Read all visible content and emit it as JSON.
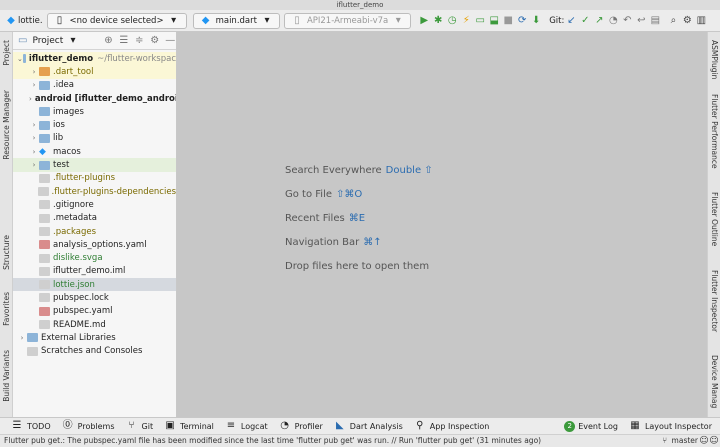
{
  "window": {
    "title": "iflutter_demo"
  },
  "toolbar": {
    "project_crumb": "lottie.",
    "device": "<no device selected>",
    "run_config": "main.dart",
    "emulator": "API21-Armeabi-v7a",
    "git_label": "Git:"
  },
  "project_panel": {
    "title": "Project",
    "tree": [
      {
        "label": "iflutter_demo",
        "extra": "~/flutter-workspac",
        "depth": 0,
        "expand": "open",
        "icon": "folder",
        "bold": true,
        "color": "#222",
        "hl": "yellow"
      },
      {
        "label": ".dart_tool",
        "depth": 1,
        "expand": "closed",
        "icon": "folder-orange",
        "color": "#7a6a00",
        "hl": "yellow"
      },
      {
        "label": ".idea",
        "depth": 1,
        "expand": "closed",
        "icon": "folder",
        "color": "#222",
        "hl": ""
      },
      {
        "label": "android [iflutter_demo_androi",
        "depth": 1,
        "expand": "closed",
        "icon": "folder",
        "bold": true,
        "color": "#222",
        "hl": ""
      },
      {
        "label": "images",
        "depth": 1,
        "expand": "none",
        "icon": "folder",
        "color": "#222",
        "hl": ""
      },
      {
        "label": "ios",
        "depth": 1,
        "expand": "closed",
        "icon": "folder",
        "color": "#222",
        "hl": ""
      },
      {
        "label": "lib",
        "depth": 1,
        "expand": "closed",
        "icon": "folder",
        "color": "#222",
        "hl": ""
      },
      {
        "label": "macos",
        "depth": 1,
        "expand": "closed",
        "icon": "flutter",
        "color": "#222",
        "hl": ""
      },
      {
        "label": "test",
        "depth": 1,
        "expand": "closed",
        "icon": "folder",
        "color": "#222",
        "hl": "green"
      },
      {
        "label": ".flutter-plugins",
        "depth": 1,
        "expand": "none",
        "icon": "file",
        "color": "#7a6a00",
        "hl": ""
      },
      {
        "label": ".flutter-plugins-dependencies",
        "depth": 1,
        "expand": "none",
        "icon": "file",
        "color": "#7a6a00",
        "hl": ""
      },
      {
        "label": ".gitignore",
        "depth": 1,
        "expand": "none",
        "icon": "file",
        "color": "#222",
        "hl": ""
      },
      {
        "label": ".metadata",
        "depth": 1,
        "expand": "none",
        "icon": "file",
        "color": "#222",
        "hl": ""
      },
      {
        "label": ".packages",
        "depth": 1,
        "expand": "none",
        "icon": "file",
        "color": "#7a6a00",
        "hl": ""
      },
      {
        "label": "analysis_options.yaml",
        "depth": 1,
        "expand": "none",
        "icon": "yaml",
        "color": "#222",
        "hl": ""
      },
      {
        "label": "dislike.svga",
        "depth": 1,
        "expand": "none",
        "icon": "file",
        "color": "#2e7d32",
        "hl": ""
      },
      {
        "label": "iflutter_demo.iml",
        "depth": 1,
        "expand": "none",
        "icon": "file",
        "color": "#222",
        "hl": ""
      },
      {
        "label": "lottie.json",
        "depth": 1,
        "expand": "none",
        "icon": "file",
        "color": "#2e7d32",
        "hl": "sel"
      },
      {
        "label": "pubspec.lock",
        "depth": 1,
        "expand": "none",
        "icon": "file",
        "color": "#222",
        "hl": ""
      },
      {
        "label": "pubspec.yaml",
        "depth": 1,
        "expand": "none",
        "icon": "yaml",
        "color": "#222",
        "hl": ""
      },
      {
        "label": "README.md",
        "depth": 1,
        "expand": "none",
        "icon": "file",
        "color": "#222",
        "hl": ""
      },
      {
        "label": "External Libraries",
        "depth": 0,
        "expand": "closed",
        "icon": "lib",
        "color": "#222",
        "hl": ""
      },
      {
        "label": "Scratches and Consoles",
        "depth": 0,
        "expand": "none",
        "icon": "scratch",
        "color": "#222",
        "hl": ""
      }
    ]
  },
  "editor_hints": [
    {
      "text": "Search Everywhere",
      "key": "Double ⇧"
    },
    {
      "text": "Go to File",
      "key": "⇧⌘O"
    },
    {
      "text": "Recent Files",
      "key": "⌘E"
    },
    {
      "text": "Navigation Bar",
      "key": "⌘↑"
    },
    {
      "text": "Drop files here to open them",
      "key": ""
    }
  ],
  "left_tool_tabs": [
    "Project",
    "Resource Manager",
    "Structure",
    "Favorites",
    "Build Variants"
  ],
  "right_tool_tabs": [
    "ASMPlugin",
    "Flutter Performance",
    "Flutter Outline",
    "Flutter Inspector",
    "Device Manag"
  ],
  "bottom_tabs": [
    "TODO",
    "Problems",
    "Git",
    "Terminal",
    "Logcat",
    "Profiler",
    "Dart Analysis",
    "App Inspection"
  ],
  "bottom_right_tabs": [
    "Event Log",
    "Layout Inspector"
  ],
  "event_log_count": "2",
  "status": {
    "message": "Flutter pub get.: The pubspec.yaml file has been modified since the last time 'flutter pub get' was run. // Run 'flutter pub get' (31 minutes ago)",
    "branch": "master"
  }
}
